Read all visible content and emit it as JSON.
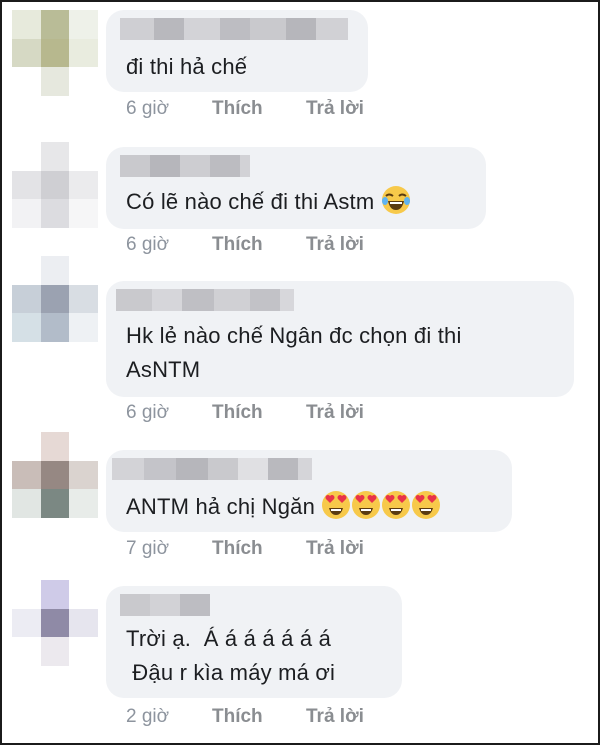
{
  "comments": [
    {
      "text_lines": [
        "đi thi hả chế"
      ],
      "time": "6 giờ",
      "like_label": "Thích",
      "reply_label": "Trả lời",
      "emoji": []
    },
    {
      "text_lines": [
        "Có lẽ nào chế đi thi Astm"
      ],
      "time": "6 giờ",
      "like_label": "Thích",
      "reply_label": "Trả lời",
      "emoji": [
        "laughing-tears-emoji"
      ]
    },
    {
      "text_lines": [
        "Hk lẻ nào chế Ngân đc chọn đi thi",
        "AsNTM"
      ],
      "time": "6 giờ",
      "like_label": "Thích",
      "reply_label": "Trả lời",
      "emoji": []
    },
    {
      "text_lines": [
        "ANTM hả chị Ngăn"
      ],
      "time": "7 giờ",
      "like_label": "Thích",
      "reply_label": "Trả lời",
      "emoji": [
        "heart-eyes-emoji",
        "heart-eyes-emoji",
        "heart-eyes-emoji",
        "heart-eyes-emoji"
      ]
    },
    {
      "text_lines": [
        "Trời ạ.  Á á á á á á á",
        " Đậu r kìa máy má ơi"
      ],
      "time": "2 giờ",
      "like_label": "Thích",
      "reply_label": "Trả lời",
      "emoji": []
    }
  ],
  "colors": {
    "bubble": "#f0f2f5",
    "text": "#1c1e21",
    "meta": "#8a8d91",
    "border": "#1b1b1b"
  }
}
